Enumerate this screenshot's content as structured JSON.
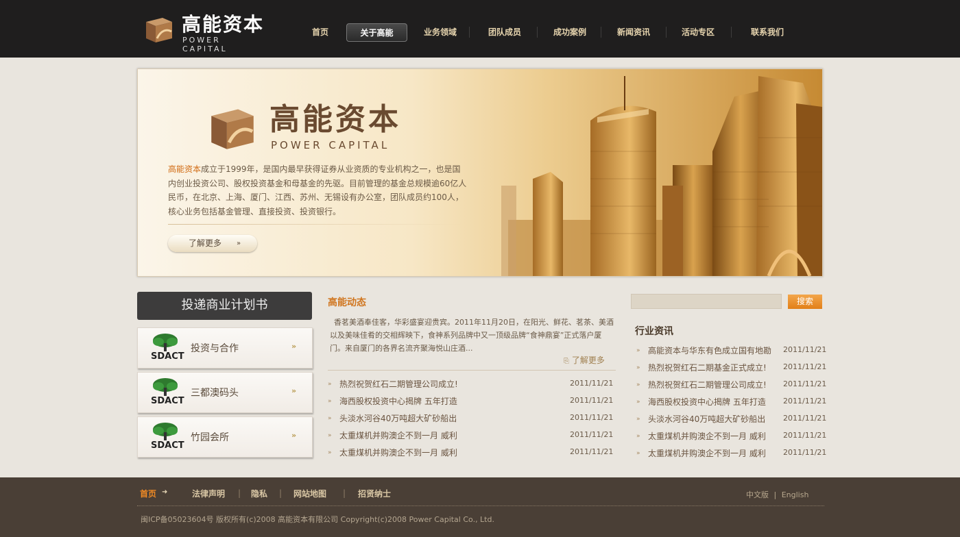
{
  "header": {
    "logo_cn": "高能资本",
    "logo_en": "POWER CAPITAL",
    "nav": [
      "首页",
      "关于高能",
      "业务领域",
      "团队成员",
      "成功案例",
      "新闻资讯",
      "活动专区",
      "联系我们"
    ],
    "active_nav": "关于高能"
  },
  "banner": {
    "logo_cn": "高能资本",
    "logo_en": "POWER CAPITAL",
    "intro_highlight": "高能资本",
    "intro_rest": "成立于1999年，是国内最早获得证券从业资质的专业机构之一，也是国内创业投资公司、股权投资基金和母基金的先驱。目前管理的基金总规模逾60亿人民币，在北京、上海、厦门、江西、苏州、无锡设有办公室，团队成员约100人，核心业务包括基金管理、直接投资、投资银行。",
    "more_label": "了解更多",
    "more_arrow": "»"
  },
  "left": {
    "business_plan_label": "投递商业计划书",
    "card_logo_text": "SDACT",
    "cards": [
      {
        "label": "投资与合作"
      },
      {
        "label": "三都澳码头"
      },
      {
        "label": "竹园会所"
      }
    ],
    "card_arrow": "»"
  },
  "middle": {
    "title": "高能动态",
    "summary": "香茗美酒奉佳客，华彩盛宴迎贵宾。2011年11月20日，在阳光、鲜花、茗茶、美酒以及美味佳肴的交相辉映下，食神系列品牌中又一顶级品牌“食神鼎宴”正式落户厦门。来自厦门的各界名流齐聚海悦山庄酒...",
    "more_label": "了解更多",
    "news": [
      {
        "title": "热烈祝贺红石二期管理公司成立!",
        "date": "2011/11/21"
      },
      {
        "title": "海西股权投资中心揭牌  五年打造",
        "date": "2011/11/21"
      },
      {
        "title": "头淡水河谷40万吨超大矿砂船出",
        "date": "2011/11/21"
      },
      {
        "title": "太重煤机并购澳企不到一月  威利",
        "date": "2011/11/21"
      },
      {
        "title": "太重煤机并购澳企不到一月  威利",
        "date": "2011/11/21"
      }
    ]
  },
  "right": {
    "search_placeholder": "",
    "search_label": "搜索",
    "title": "行业资讯",
    "news": [
      {
        "title": "高能资本与华东有色成立国有地勘",
        "date": "2011/11/21"
      },
      {
        "title": "热烈祝贺红石二期基金正式成立!",
        "date": "2011/11/21"
      },
      {
        "title": "热烈祝贺红石二期管理公司成立!",
        "date": "2011/11/21"
      },
      {
        "title": "海西股权投资中心揭牌  五年打造",
        "date": "2011/11/21"
      },
      {
        "title": "头淡水河谷40万吨超大矿砂船出",
        "date": "2011/11/21"
      },
      {
        "title": "太重煤机并购澳企不到一月  威利",
        "date": "2011/11/21"
      },
      {
        "title": "太重煤机并购澳企不到一月  威利",
        "date": "2011/11/21"
      }
    ]
  },
  "footer": {
    "nav": [
      "首页",
      "法律声明",
      "隐私",
      "网站地图",
      "招贤纳士"
    ],
    "active_nav": "首页",
    "active_arrow": "➜",
    "lang_cn": "中文版",
    "lang_sep": "|",
    "lang_en": "English",
    "copyright": "闽ICP备05023604号  版权所有(c)2008  高能资本有限公司  Copyright(c)2008 Power Capital Co., Ltd."
  },
  "colors": {
    "header_bg": "#1f1e1e",
    "accent_orange": "#d0751e",
    "footer_bg": "#4a3f36",
    "page_bg": "#e9e5de"
  }
}
